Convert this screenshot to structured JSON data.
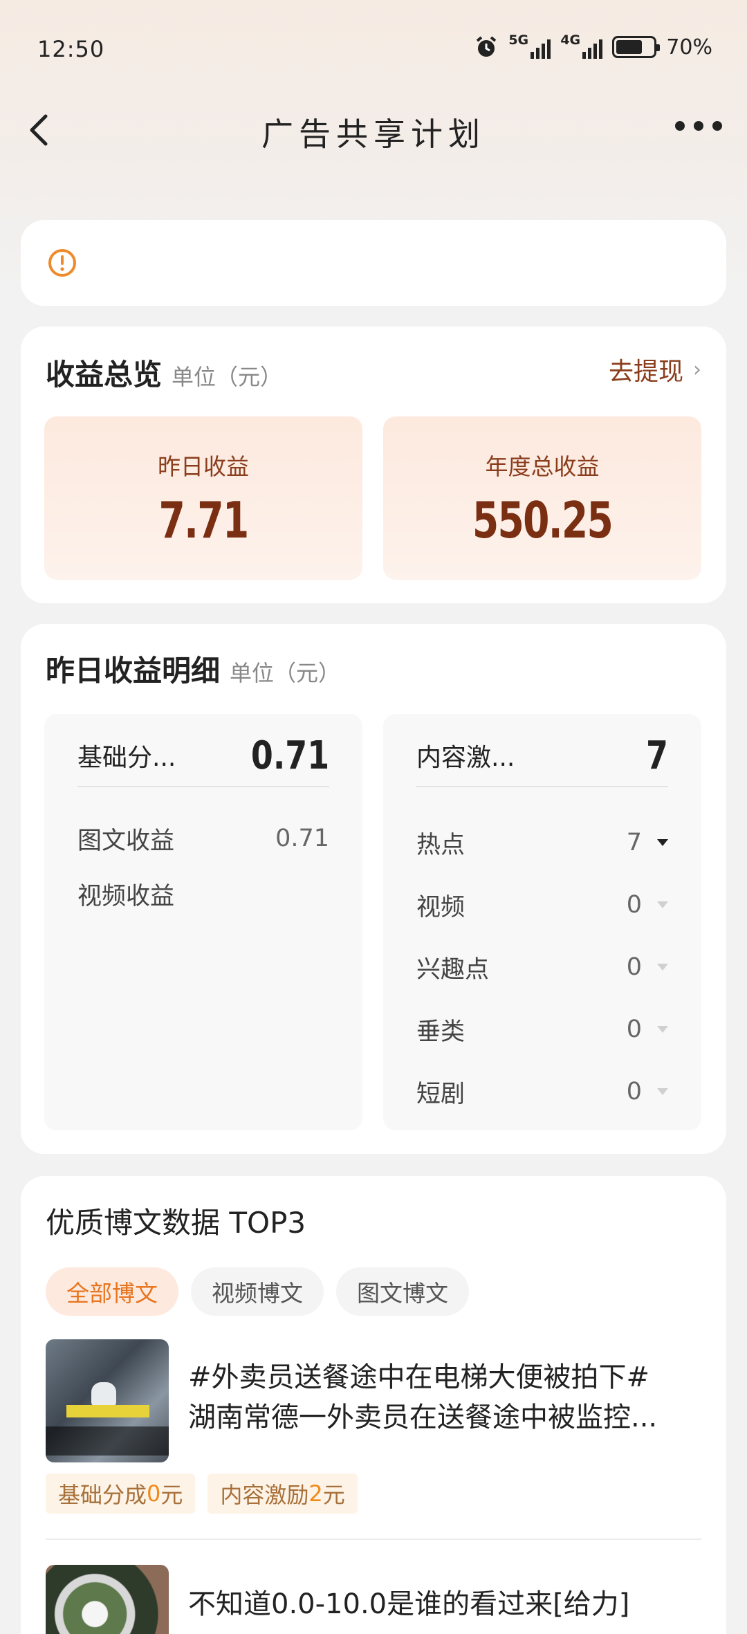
{
  "status": {
    "time": "12:50",
    "net1": "5G",
    "net2": "4G",
    "battery_pct": "70%",
    "battery_level": 0.7
  },
  "nav": {
    "title": "广告共享计划"
  },
  "overview": {
    "title": "收益总览",
    "unit": "单位（元）",
    "withdraw": "去提现",
    "yesterday_label": "昨日收益",
    "yesterday_value": "7.71",
    "annual_label": "年度总收益",
    "annual_value": "550.25"
  },
  "detail": {
    "title": "昨日收益明细",
    "unit": "单位（元）",
    "left": {
      "header_label": "基础分...",
      "header_value": "0.71",
      "rows": [
        {
          "label": "图文收益",
          "value": "0.71"
        },
        {
          "label": "视频收益",
          "value": ""
        }
      ]
    },
    "right": {
      "header_label": "内容激...",
      "header_value": "7",
      "rows": [
        {
          "label": "热点",
          "value": "7"
        },
        {
          "label": "视频",
          "value": "0"
        },
        {
          "label": "兴趣点",
          "value": "0"
        },
        {
          "label": "垂类",
          "value": "0"
        },
        {
          "label": "短剧",
          "value": "0"
        }
      ]
    }
  },
  "top3": {
    "title": "优质博文数据 TOP3",
    "tabs": [
      "全部博文",
      "视频博文",
      "图文博文"
    ],
    "posts": [
      {
        "line1": "#外卖员送餐途中在电梯大便被拍下#",
        "line2": "湖南常德一外卖员在送餐途中被监控...",
        "chip1_label": "基础分成",
        "chip1_value": "0",
        "chip1_unit": "元",
        "chip2_label": "内容激励",
        "chip2_value": "2",
        "chip2_unit": "元"
      },
      {
        "line1": "不知道0.0-10.0是谁的看过来[给力]"
      }
    ]
  },
  "colors": {
    "accent": "#e8751f",
    "brown": "#7a2f12",
    "card_bg": "#ffffff"
  }
}
